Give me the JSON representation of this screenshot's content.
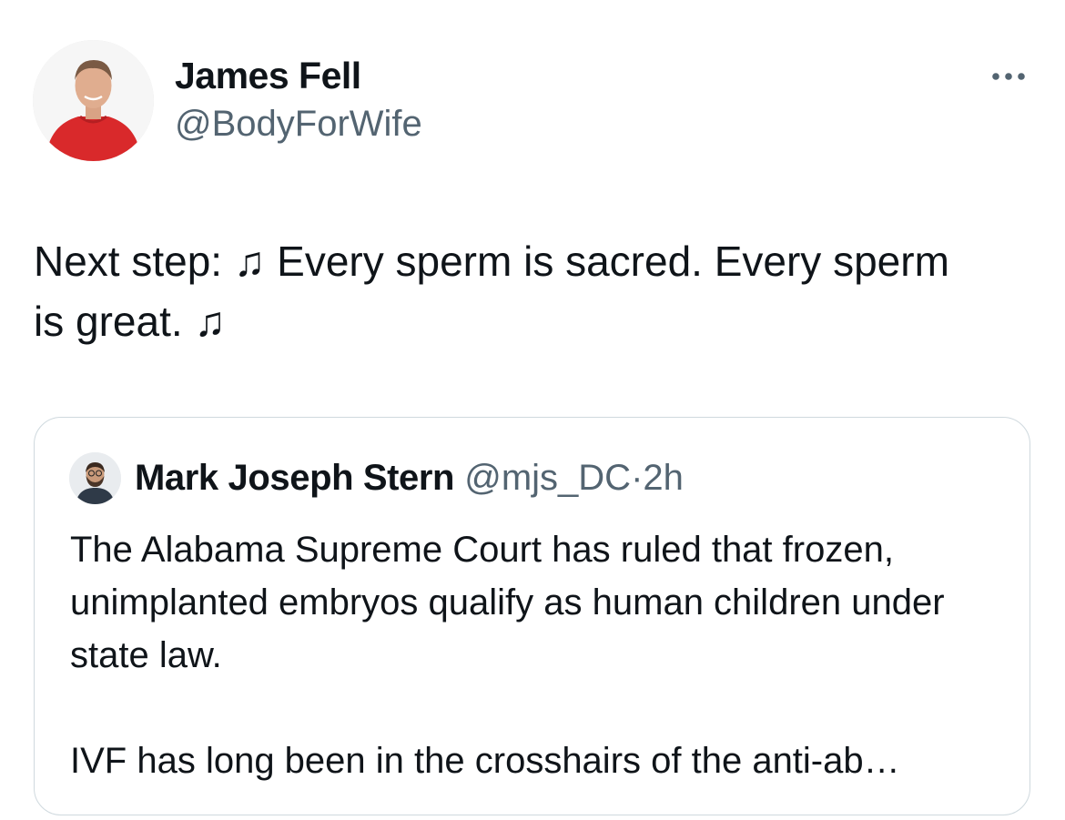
{
  "author": {
    "name": "James Fell",
    "handle": "@BodyForWife",
    "avatar_icon": "person-red-shirt-avatar"
  },
  "more_icon": "more-dots-icon",
  "tweet": {
    "text": "Next step: ♫ Every sperm is sacred. Every sperm is great. ♫"
  },
  "quote": {
    "author_name": "Mark Joseph Stern",
    "handle": "@mjs_DC",
    "separator": "·",
    "time": "2h",
    "avatar_icon": "person-bearded-avatar",
    "paragraph1": "The Alabama Supreme Court has ruled that frozen, unimplanted embryos qualify as human children under state law.",
    "paragraph2": "IVF has long been in the crosshairs of the anti-ab…"
  },
  "colors": {
    "text": "#0f1419",
    "secondary": "#536471",
    "border": "#cfd9de",
    "shirt": "#d9292b"
  }
}
